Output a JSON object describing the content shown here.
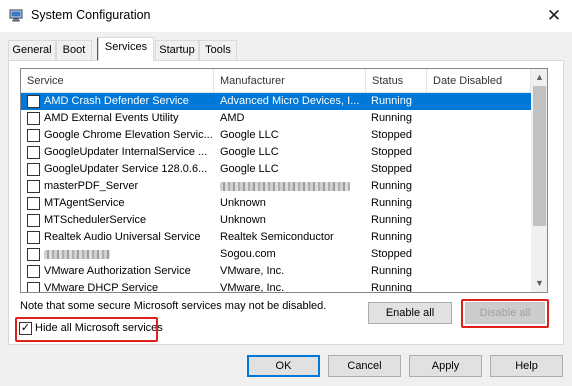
{
  "window": {
    "title": "System Configuration",
    "close_glyph": "✕"
  },
  "tabs": [
    {
      "label": "General"
    },
    {
      "label": "Boot"
    },
    {
      "label": "Services"
    },
    {
      "label": "Startup"
    },
    {
      "label": "Tools"
    }
  ],
  "table": {
    "columns": [
      "Service",
      "Manufacturer",
      "Status",
      "Date Disabled"
    ],
    "rows": [
      {
        "service": "AMD Crash Defender Service",
        "manufacturer": "Advanced Micro Devices, I...",
        "status": "Running",
        "checked": false,
        "selected": true
      },
      {
        "service": "AMD External Events Utility",
        "manufacturer": "AMD",
        "status": "Running",
        "checked": false
      },
      {
        "service": "Google Chrome Elevation Servic...",
        "manufacturer": "Google LLC",
        "status": "Stopped",
        "checked": false
      },
      {
        "service": "GoogleUpdater InternalService ...",
        "manufacturer": "Google LLC",
        "status": "Stopped",
        "checked": false
      },
      {
        "service": "GoogleUpdater Service 128.0.6...",
        "manufacturer": "Google LLC",
        "status": "Stopped",
        "checked": false
      },
      {
        "service": "masterPDF_Server",
        "manufacturer": "",
        "manufacturer_redacted": true,
        "status": "Running",
        "checked": false
      },
      {
        "service": "MTAgentService",
        "manufacturer": "Unknown",
        "status": "Running",
        "checked": false
      },
      {
        "service": "MTSchedulerService",
        "manufacturer": "Unknown",
        "status": "Running",
        "checked": false
      },
      {
        "service": "Realtek Audio Universal Service",
        "manufacturer": "Realtek Semiconductor",
        "status": "Running",
        "checked": false
      },
      {
        "service": "",
        "service_redacted": true,
        "manufacturer": "Sogou.com",
        "status": "Stopped",
        "checked": false
      },
      {
        "service": "VMware Authorization Service",
        "manufacturer": "VMware, Inc.",
        "status": "Running",
        "checked": false
      },
      {
        "service": "VMware DHCP Service",
        "manufacturer": "VMware, Inc.",
        "status": "Running",
        "checked": false
      }
    ]
  },
  "note": "Note that some secure Microsoft services may not be disabled.",
  "buttons": {
    "enable_all": "Enable all",
    "disable_all": "Disable all",
    "ok": "OK",
    "cancel": "Cancel",
    "apply": "Apply",
    "help": "Help"
  },
  "hide_ms": {
    "label": "Hide all Microsoft services",
    "checked": true,
    "check_glyph": "✓"
  },
  "colors": {
    "selection": "#0078d7",
    "highlight_box": "#e0201b"
  }
}
